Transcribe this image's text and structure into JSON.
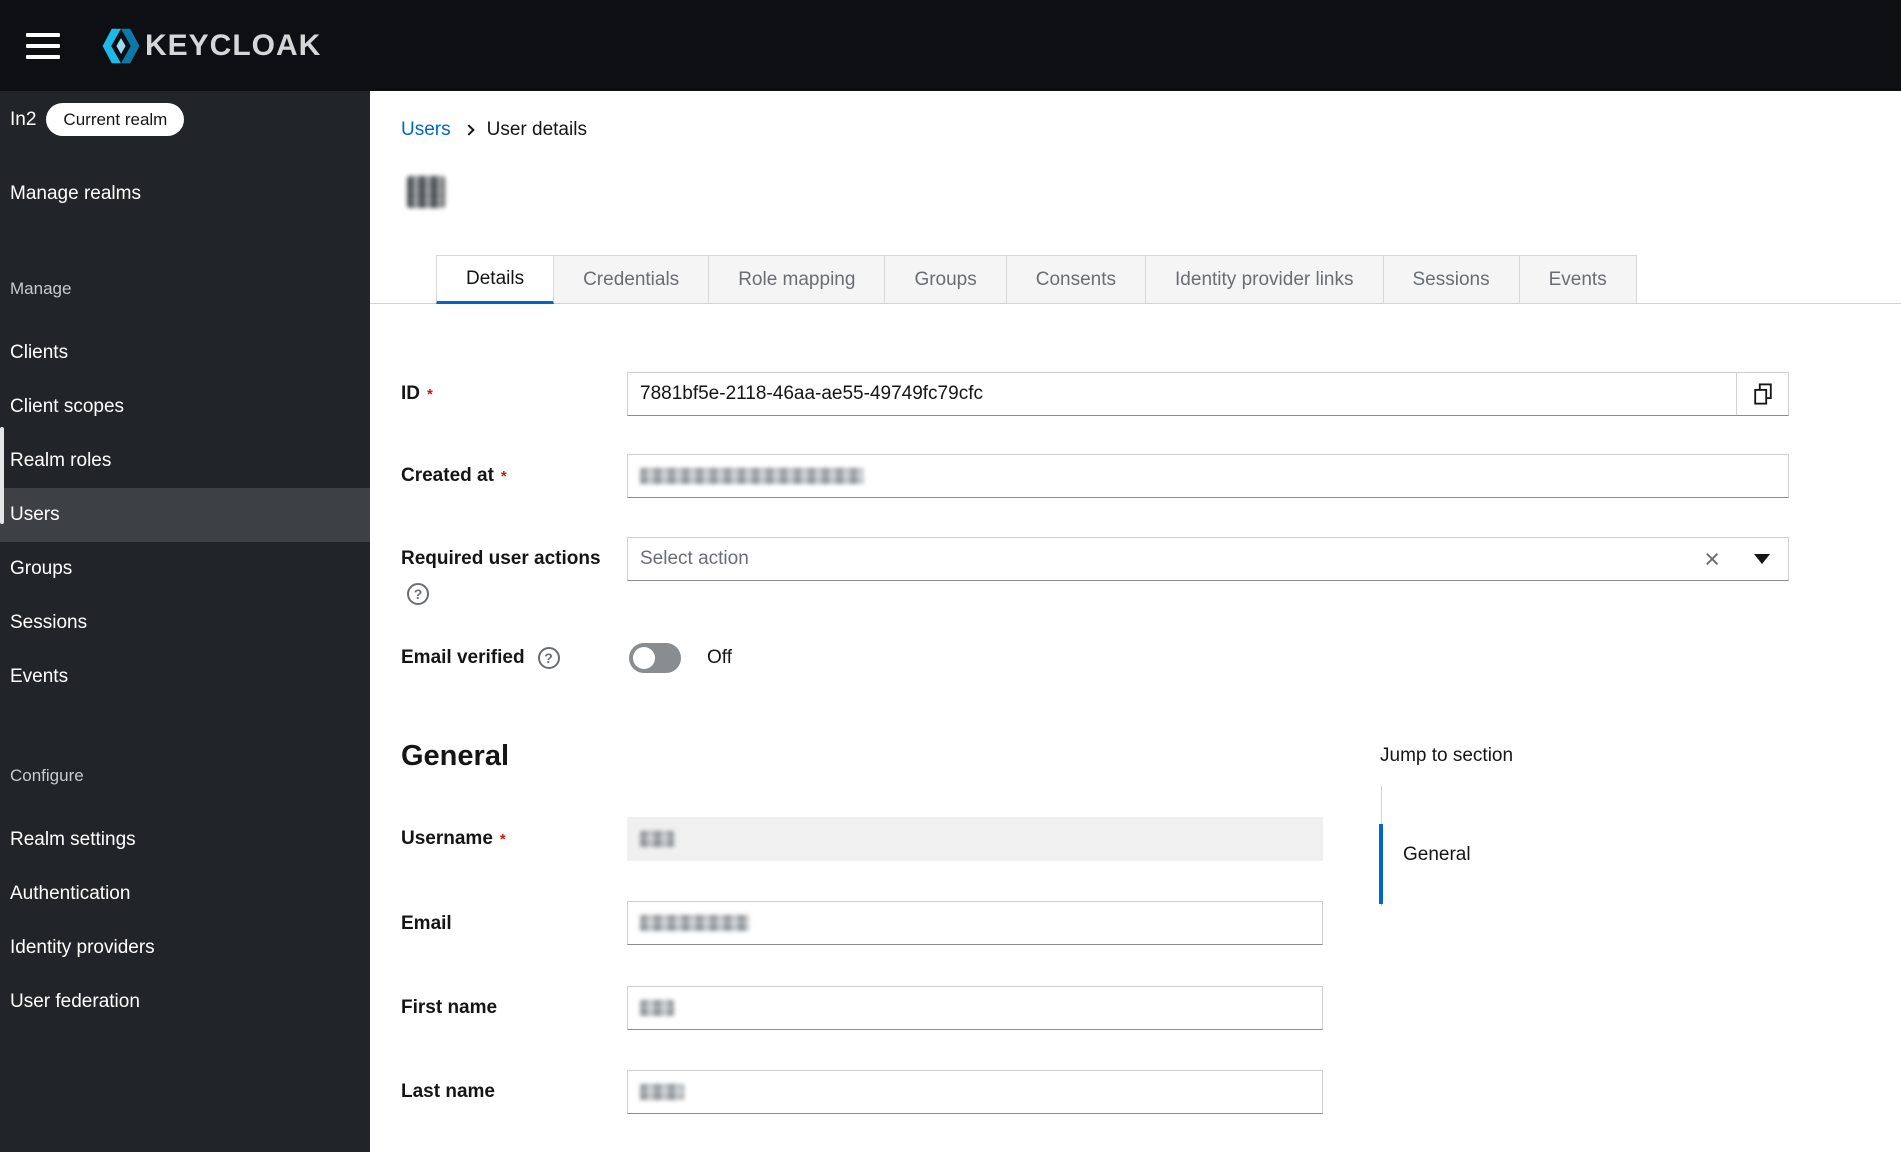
{
  "header": {
    "brand": "KEYCLOAK"
  },
  "sidebar": {
    "realm_name": "In2",
    "realm_badge": "Current realm",
    "manage_realms_label": "Manage realms",
    "groups": [
      {
        "label": "Manage",
        "items": [
          {
            "label": "Clients",
            "active": false
          },
          {
            "label": "Client scopes",
            "active": false
          },
          {
            "label": "Realm roles",
            "active": false
          },
          {
            "label": "Users",
            "active": true
          },
          {
            "label": "Groups",
            "active": false
          },
          {
            "label": "Sessions",
            "active": false
          },
          {
            "label": "Events",
            "active": false
          }
        ]
      },
      {
        "label": "Configure",
        "items": [
          {
            "label": "Realm settings",
            "active": false
          },
          {
            "label": "Authentication",
            "active": false
          },
          {
            "label": "Identity providers",
            "active": false
          },
          {
            "label": "User federation",
            "active": false
          }
        ]
      }
    ]
  },
  "breadcrumb": {
    "users_link": "Users",
    "current": "User details"
  },
  "tabs": {
    "active": "Details",
    "items": [
      "Details",
      "Credentials",
      "Role mapping",
      "Groups",
      "Consents",
      "Identity provider links",
      "Sessions",
      "Events"
    ]
  },
  "form": {
    "required_marker": "*",
    "id_label": "ID",
    "id_value": "7881bf5e-2118-46aa-ae55-49749fc79cfc",
    "created_at_label": "Created at",
    "required_user_actions_label": "Required user actions",
    "required_user_actions_placeholder": "Select action",
    "email_verified_label": "Email verified",
    "email_verified_state": "Off",
    "section_general_heading": "General",
    "username_label": "Username",
    "email_label": "Email",
    "first_name_label": "First name",
    "last_name_label": "Last name"
  },
  "jump": {
    "title": "Jump to section",
    "general": "General"
  },
  "icons": {
    "help_glyph": "?",
    "clear_glyph": "×"
  },
  "colors": {
    "accent_blue": "#0066cc",
    "link_blue": "#0066cc",
    "required_red": "#c9190b",
    "masthead_black": "#0d0f12",
    "sidebar_dark": "#212428",
    "sidebar_active": "#3d4044"
  }
}
